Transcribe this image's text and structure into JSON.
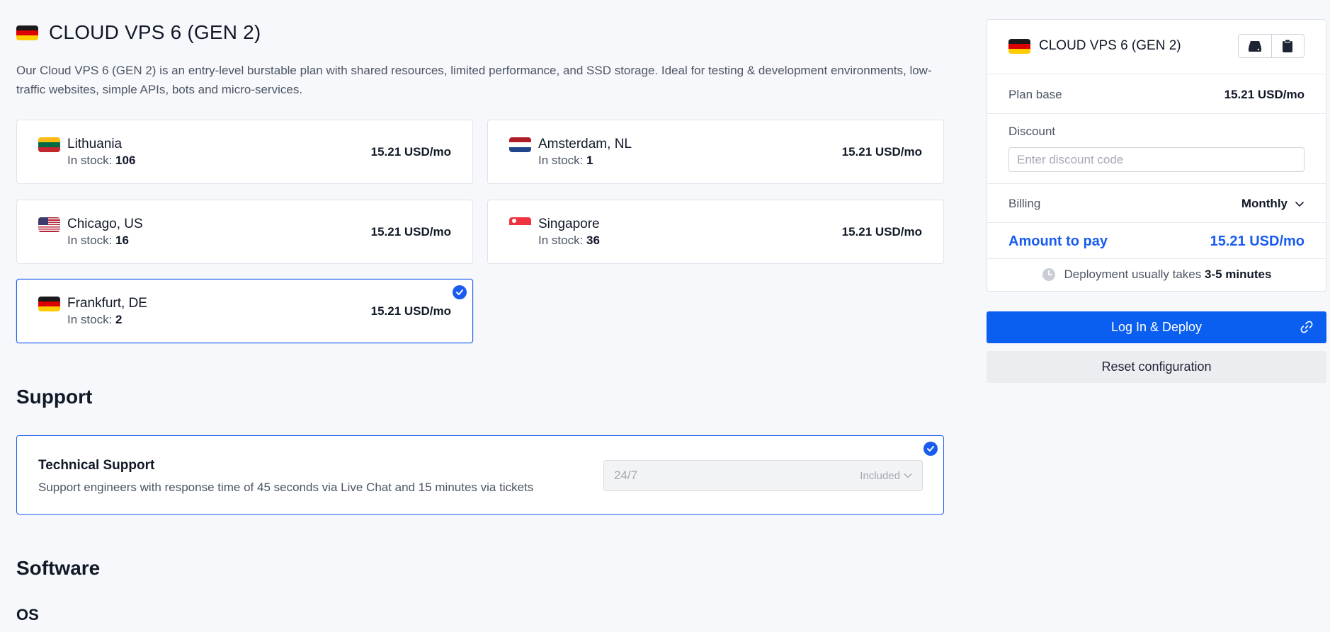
{
  "plan": {
    "title": "CLOUD VPS 6 (GEN 2)",
    "description": "Our Cloud VPS 6 (GEN 2) is an entry-level burstable plan with shared resources, limited performance, and SSD storage. Ideal for testing & development environments, low-traffic websites, simple APIs, bots and micro-services."
  },
  "stock_label": "In stock:",
  "locations": [
    {
      "name": "Lithuania",
      "stock": "106",
      "price": "15.21 USD/mo",
      "flag": "flag-lt"
    },
    {
      "name": "Amsterdam, NL",
      "stock": "1",
      "price": "15.21 USD/mo",
      "flag": "flag-nl"
    },
    {
      "name": "Chicago, US",
      "stock": "16",
      "price": "15.21 USD/mo",
      "flag": "flag-us"
    },
    {
      "name": "Singapore",
      "stock": "36",
      "price": "15.21 USD/mo",
      "flag": "flag-sg"
    },
    {
      "name": "Frankfurt, DE",
      "stock": "2",
      "price": "15.21 USD/mo",
      "flag": "flag-de",
      "selected": true
    }
  ],
  "support": {
    "heading": "Support",
    "card_title": "Technical Support",
    "card_desc": "Support engineers with response time of 45 seconds via Live Chat and 15 minutes via tickets",
    "select_value": "24/7",
    "select_badge": "Included"
  },
  "software": {
    "heading": "Software",
    "os_heading": "OS"
  },
  "summary": {
    "title": "CLOUD VPS 6 (GEN 2)",
    "plan_base_label": "Plan base",
    "plan_base_value": "15.21 USD/mo",
    "discount_label": "Discount",
    "discount_placeholder": "Enter discount code",
    "billing_label": "Billing",
    "billing_value": "Monthly",
    "amount_label": "Amount to pay",
    "amount_value": "15.21 USD/mo",
    "deploy_note_prefix": "Deployment usually takes",
    "deploy_note_time": "3-5 minutes"
  },
  "buttons": {
    "deploy": "Log In & Deploy",
    "reset": "Reset configuration"
  },
  "colors": {
    "accent": "#1a5cf0",
    "primary_button": "#0a5ef0",
    "background": "#f7f8fb"
  },
  "icons": [
    "germany-flag-icon",
    "server-icon",
    "clipboard-icon",
    "checkmark-icon",
    "chevron-down-icon",
    "clock-icon",
    "link-icon"
  ]
}
